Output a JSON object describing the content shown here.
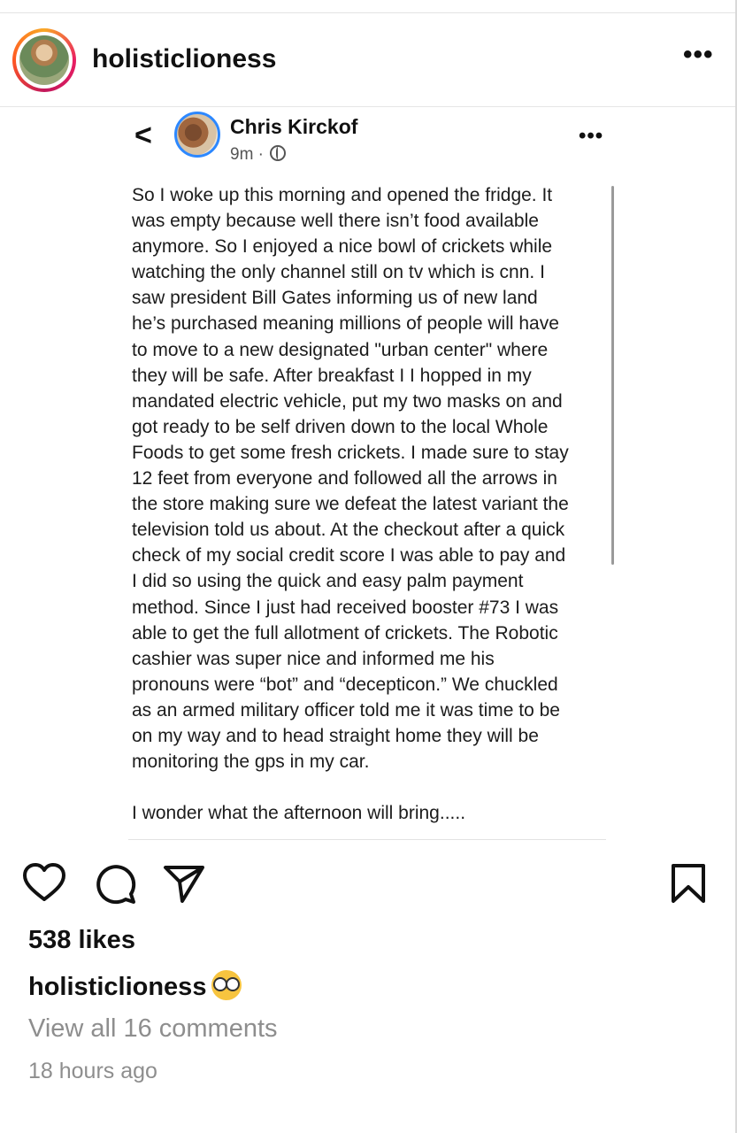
{
  "post_header": {
    "username": "holisticlioness",
    "more_label": "•••"
  },
  "embedded_post": {
    "back_label": "<",
    "author": "Chris Kirckof",
    "time": "9m · ",
    "more_label": "•••",
    "body": "So I woke up this morning and opened the fridge. It\nwas empty because well there isn’t food available\nanymore. So I enjoyed a nice bowl of crickets while\nwatching the only channel still on tv which is cnn. I\nsaw president Bill Gates informing us of new land\nhe’s purchased meaning millions of people will have\nto move to a new designated \"urban center\" where\nthey will be safe. After breakfast I I hopped in my\nmandated electric vehicle, put my two masks on and\ngot ready to be self driven down to the local Whole\nFoods to get some fresh crickets. I made sure to stay\n12 feet from everyone and followed all the arrows in\nthe store making sure we defeat the latest variant the\ntelevision told us about. At the checkout after a quick\ncheck of my social credit score I was able to pay and\nI did so using the quick and easy palm payment\nmethod. Since I just had received booster #73 I was\nable to get the full allotment of crickets. The Robotic\ncashier was super nice and informed me his\npronouns were “bot” and “decepticon.” We chuckled\nas an armed military officer told me it was time to be\non my way and to head straight home they will be\nmonitoring the gps in my car.\n\nI wonder what the afternoon will bring....."
  },
  "actions": {
    "like_icon": "heart-icon",
    "comment_icon": "comment-icon",
    "share_icon": "send-icon",
    "save_icon": "bookmark-icon"
  },
  "footer": {
    "likes": "538 likes",
    "caption_user": "holisticlioness",
    "caption_emoji": "nerd-face-emoji",
    "view_comments": "View all 16 comments",
    "timestamp": "18 hours ago"
  }
}
